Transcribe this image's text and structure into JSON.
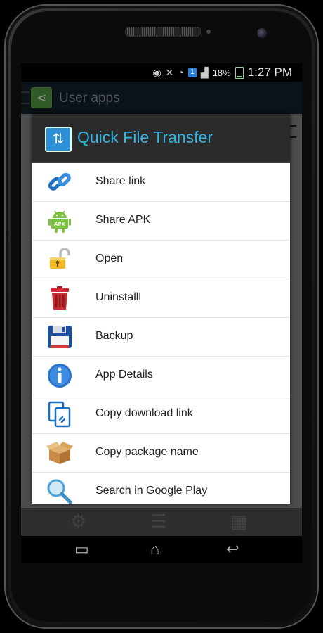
{
  "status_bar": {
    "battery": "18%",
    "time": "1:27 PM",
    "sim": "1"
  },
  "app": {
    "title": "User apps"
  },
  "dialog": {
    "title": "Quick File Transfer",
    "items": [
      {
        "label": "Share link",
        "icon": "link-icon"
      },
      {
        "label": "Share APK",
        "icon": "android-apk-icon"
      },
      {
        "label": "Open",
        "icon": "unlock-icon"
      },
      {
        "label": "Uninstalll",
        "icon": "trash-icon"
      },
      {
        "label": "Backup",
        "icon": "floppy-icon"
      },
      {
        "label": "App Details",
        "icon": "info-icon"
      },
      {
        "label": "Copy download link",
        "icon": "copy-link-icon"
      },
      {
        "label": "Copy package name",
        "icon": "box-icon"
      },
      {
        "label": "Search in Google Play",
        "icon": "magnifier-icon"
      }
    ]
  },
  "colors": {
    "accent": "#33b5e5",
    "header": "#2b2b2b"
  }
}
